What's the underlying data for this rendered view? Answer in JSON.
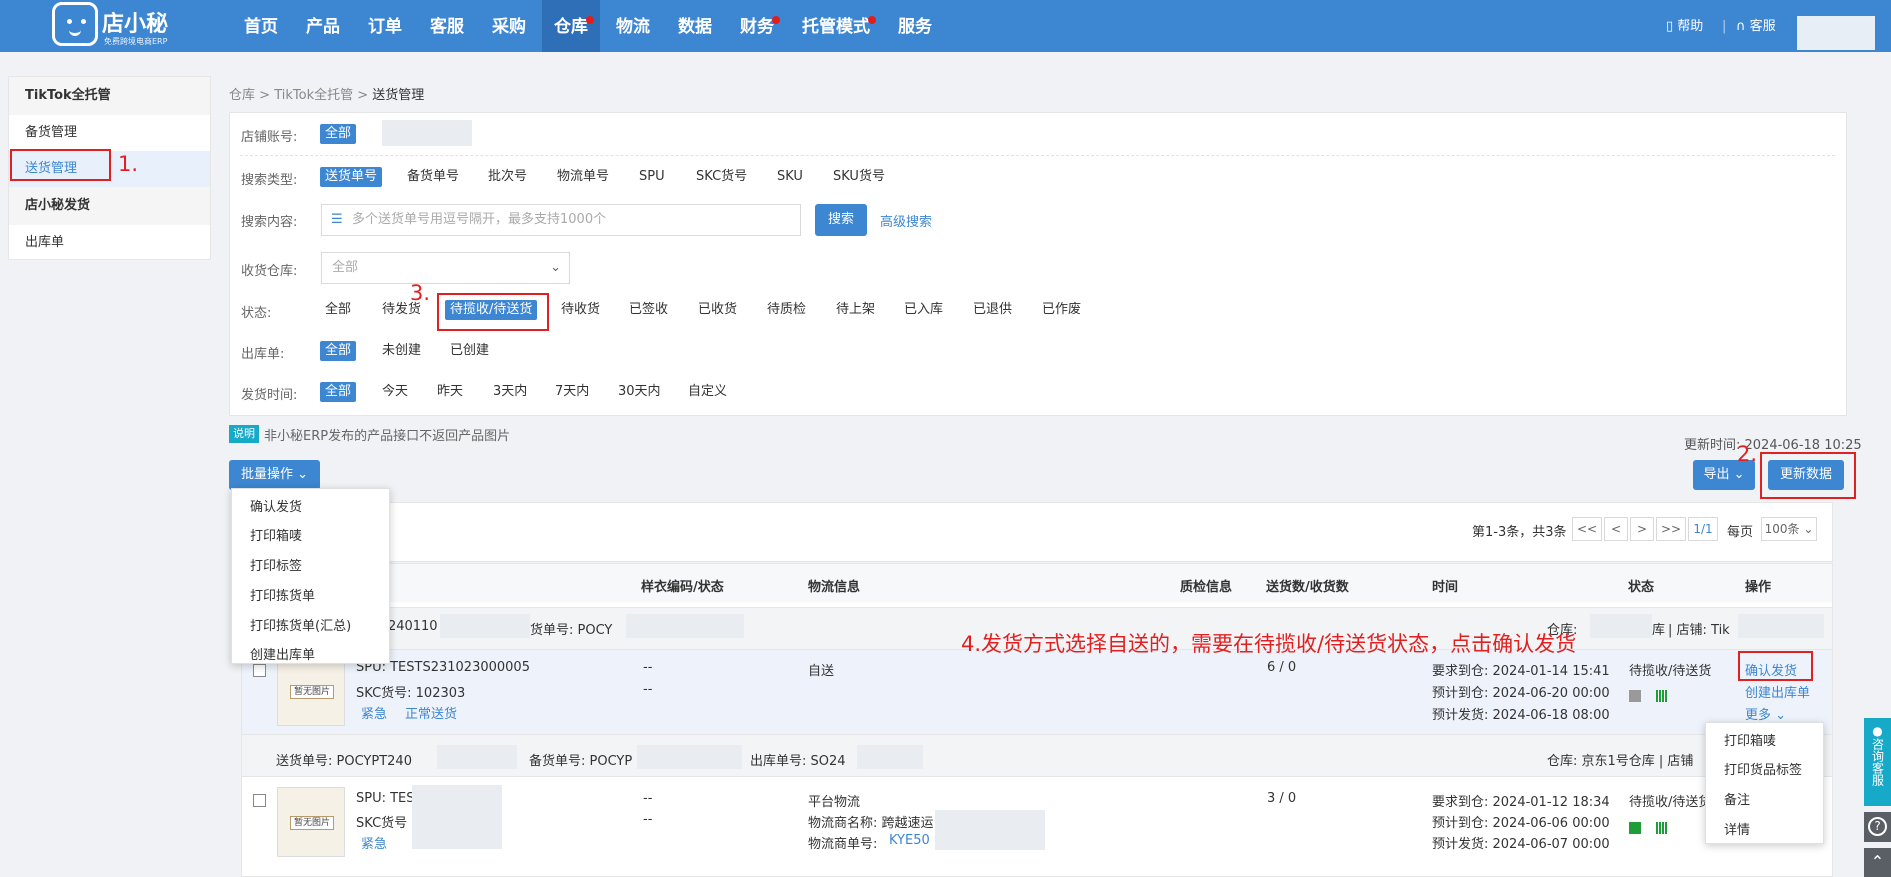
{
  "app": {
    "logo_name": "店小秘",
    "logo_sub": "免费跨境电商ERP"
  },
  "nav": [
    {
      "label": "首页"
    },
    {
      "label": "产品"
    },
    {
      "label": "订单"
    },
    {
      "label": "客服"
    },
    {
      "label": "采购"
    },
    {
      "label": "仓库",
      "active": true,
      "dot": true
    },
    {
      "label": "物流"
    },
    {
      "label": "数据"
    },
    {
      "label": "财务",
      "dot": true
    },
    {
      "label": "托管模式",
      "dot": true
    },
    {
      "label": "服务"
    }
  ],
  "top_right": {
    "help": "帮助",
    "service": "客服"
  },
  "sidebar": {
    "group1": "TikTok全托管",
    "item1": "备货管理",
    "item2": "送货管理",
    "group2": "店小秘发货",
    "item3": "出库单"
  },
  "breadcrumb": {
    "a": "仓库",
    "b": "TikTok全托管",
    "c": "送货管理",
    "sep": ">"
  },
  "filters": {
    "store_label": "店铺账号:",
    "store_all": "全部",
    "search_type_label": "搜索类型:",
    "search_types": [
      "送货单号",
      "备货单号",
      "批次号",
      "物流单号",
      "SPU",
      "SKC货号",
      "SKU",
      "SKU货号"
    ],
    "search_content_label": "搜索内容:",
    "search_placeholder": "多个送货单号用逗号隔开，最多支持1000个",
    "search_btn": "搜索",
    "advanced": "高级搜索",
    "warehouse_label": "收货仓库:",
    "warehouse_value": "全部",
    "status_label": "状态:",
    "statuses": [
      "全部",
      "待发货",
      "待揽收/待送货",
      "待收货",
      "已签收",
      "已收货",
      "待质检",
      "待上架",
      "已入库",
      "已退供",
      "已作废"
    ],
    "outbound_label": "出库单:",
    "outbound_opts": [
      "全部",
      "未创建",
      "已创建"
    ],
    "time_label": "发货时间:",
    "time_opts": [
      "全部",
      "今天",
      "昨天",
      "3天内",
      "7天内",
      "30天内",
      "自定义"
    ]
  },
  "notice": {
    "tag": "说明",
    "text": "非小秘ERP发布的产品接口不返回产品图片"
  },
  "update_time": "更新时间: 2024-06-18 10:25",
  "buttons": {
    "batch": "批量操作",
    "export": "导出",
    "refresh": "更新数据"
  },
  "batch_menu": [
    "确认发货",
    "打印箱唛",
    "打印标签",
    "打印拣货单",
    "打印拣货单(汇总)",
    "创建出库单"
  ],
  "pager": {
    "summary": "第1-3条，共3条",
    "first": "<<",
    "prev": "<",
    "next": ">",
    "last": ">>",
    "page": "1/1",
    "per_label": "每页",
    "per_value": "100条"
  },
  "columns": [
    "样衣编码/状态",
    "物流信息",
    "质检信息",
    "送货数/收货数",
    "时间",
    "状态",
    "操作"
  ],
  "annotations": {
    "n1": "1.",
    "n2": "2.",
    "n3": "3.",
    "n4": "4.发货方式选择自送的，需要在待揽收/待送货状态，点击确认发货"
  },
  "rows": [
    {
      "head_left": "T240110",
      "head_mid": "货单号: POCY",
      "head_wh": "仓库:",
      "head_wh2": "库",
      "head_store": "| 店铺: Tik",
      "spu": "SPU: TESTS231023000005",
      "skc": "SKC货号: 102303",
      "tag1": "紧急",
      "tag2": "正常送货",
      "thumb": "暂无图片",
      "sample1": "--",
      "sample2": "--",
      "logistics": "自送",
      "qty": "6 / 0",
      "t1": "要求到仓: 2024-01-14 15:41",
      "t2": "预计到仓: 2024-06-20 00:00",
      "t3": "预计发货: 2024-06-18 08:00",
      "status": "待揽收/待送货",
      "op1": "确认发货",
      "op2": "创建出库单",
      "op3": "更多"
    },
    {
      "head_left": "送货单号: POCYPT240",
      "head_mid": "备货单号: POCYP",
      "head_out": "出库单号: SO24",
      "head_wh": "仓库:  京东1号仓库  |  店铺",
      "spu": "SPU: TES",
      "skc": "SKC货号",
      "tag1": "紧急",
      "thumb": "暂无图片",
      "sample1": "--",
      "sample2": "--",
      "logistics": "平台物流",
      "lg2": "物流商名称: 跨越速运",
      "lg3": "物流商单号:",
      "lg3v": "KYE50",
      "qty": "3 / 0",
      "t1": "要求到仓: 2024-01-12 18:34",
      "t2": "预计到仓: 2024-06-06 00:00",
      "t3": "预计发货: 2024-06-07 00:00",
      "status": "待揽收/待送货"
    }
  ],
  "more_menu": [
    "打印箱唛",
    "打印货品标签",
    "备注",
    "详情"
  ],
  "float": {
    "cs": "咨询客服"
  }
}
